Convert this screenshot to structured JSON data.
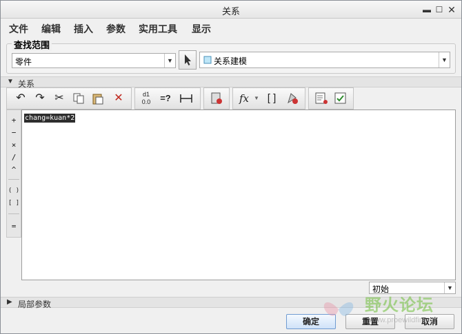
{
  "window": {
    "title": "关系"
  },
  "menu": [
    "文件",
    "编辑",
    "插入",
    "参数",
    "实用工具",
    "显示"
  ],
  "lookup": {
    "title": "查找范围",
    "type_value": "零件",
    "model_value": "关系建模"
  },
  "relations": {
    "section_label": "关系",
    "text": "chang=kuan*2",
    "operators": [
      "+",
      "−",
      "×",
      "/",
      "^",
      "( )",
      "[ ]",
      "="
    ],
    "unit_mode": "初始"
  },
  "local_params": {
    "section_label": "局部参数"
  },
  "buttons": {
    "ok": "确定",
    "reset": "重置",
    "cancel": "取消"
  },
  "watermark": {
    "text": "野火论坛",
    "url": "www.proewildfire.cn"
  }
}
